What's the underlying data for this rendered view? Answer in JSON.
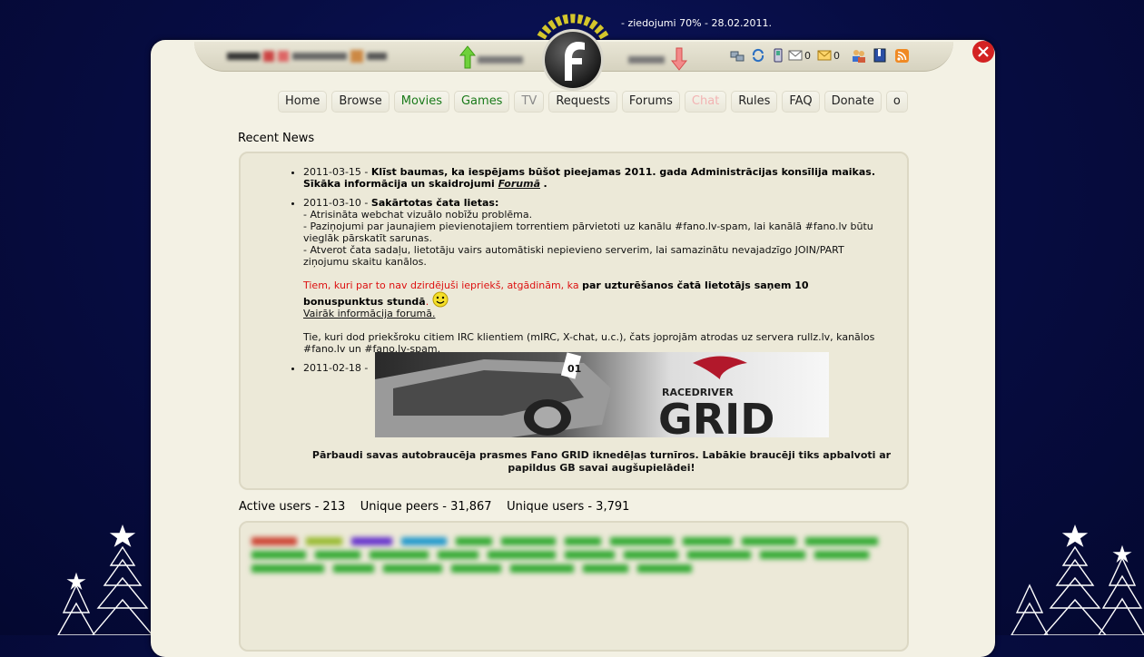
{
  "header": {
    "donation_text": "- ziedojumi 70% - 28.02.2011.",
    "mail_count": "0",
    "messages_count": "0"
  },
  "nav": [
    {
      "label": "Home",
      "style": "normal"
    },
    {
      "label": "Browse",
      "style": "normal"
    },
    {
      "label": "Movies",
      "style": "green"
    },
    {
      "label": "Games",
      "style": "green"
    },
    {
      "label": "TV",
      "style": "gray"
    },
    {
      "label": "Requests",
      "style": "normal"
    },
    {
      "label": "Forums",
      "style": "normal"
    },
    {
      "label": "Chat",
      "style": "pink"
    },
    {
      "label": "Rules",
      "style": "normal"
    },
    {
      "label": "FAQ",
      "style": "normal"
    },
    {
      "label": "Donate",
      "style": "normal"
    },
    {
      "label": "o",
      "style": "normal"
    }
  ],
  "recent_news": {
    "title": "Recent News",
    "items": [
      {
        "date": "2011-03-15",
        "headline": "Klīst baumas, ka iespējams būšot pieejamas 2011. gada Administrācijas konsīlija maikas.",
        "line2_prefix": "Sīkāka informācija un skaidrojumi ",
        "line2_link": "Forumā",
        "line2_suffix": "."
      },
      {
        "date": "2011-03-10",
        "headline": "Sakārtotas čata lietas:",
        "lines": [
          "- Atrisināta webchat vizuālo nobīžu problēma.",
          "- Paziņojumi par jaunajiem pievienotajiem torrentiem pārvietoti uz kanālu #fano.lv-spam, lai kanālā #fano.lv būtu vieglāk pārskatīt sarunas.",
          "- Atverot čata sadaļu, lietotāju vairs automātiski nepievieno serverim, lai samazinātu nevajadzīgo JOIN/PART ziņojumu skaitu kanālos."
        ],
        "notice_prefix": "Tiem, kuri par to nav dzirdējuši iepriekš, atgādinām, ka ",
        "notice_bold": "par uzturēšanos čatā lietotājs saņem 10 bonuspunktus stundā",
        "notice_suffix": ".",
        "more_link": "Vairāk informācija forumā.",
        "irc_text": "Tie, kuri dod priekšroku citiem IRC klientiem (mIRC, X-chat, u.c.), čats joprojām atrodas uz servera rullz.lv, kanālos #fano.lv un #fano.lv-spam."
      },
      {
        "date": "2011-02-18",
        "banner_brand_small": "RACEDRIVER",
        "banner_brand_big": "GRID",
        "banner_car_number": "01",
        "caption": "Pārbaudi savas autobraucēja prasmes Fano GRID iknedēļas turnīros. Labākie braucēji tiks apbalvoti ar papildus GB savai augšupielādei!"
      }
    ]
  },
  "stats": {
    "text": "Active users - 213    Unique peers - 31,867    Unique users - 3,791"
  },
  "colors": {
    "background": "#070d44",
    "panel": "#f3f1e4",
    "news_box": "#ece9d8",
    "green_link": "#1a7a1a",
    "notice_red": "#dd1111"
  },
  "icons": [
    "upload-arrow-icon",
    "download-arrow-icon",
    "logo-icon",
    "close-icon",
    "smiley-icon",
    "rss-icon",
    "mail-icon",
    "messages-icon",
    "friends-icon",
    "bookmarks-icon",
    "phone-icon",
    "refresh-icon",
    "computers-icon"
  ]
}
